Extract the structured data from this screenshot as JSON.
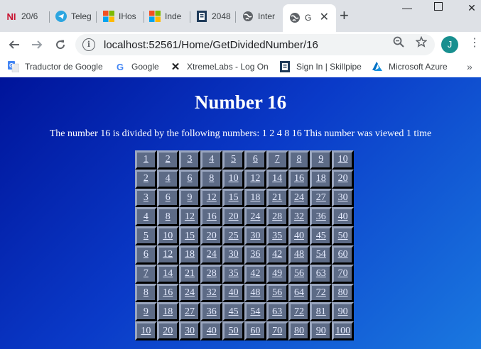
{
  "browser": {
    "tabs": [
      {
        "label": "20/6",
        "icon": "ni-icon"
      },
      {
        "label": "Teleg",
        "icon": "telegram-icon"
      },
      {
        "label": "IHos",
        "icon": "windows-icon"
      },
      {
        "label": "Inde",
        "icon": "windows-icon"
      },
      {
        "label": "2048",
        "icon": "document-icon"
      },
      {
        "label": "Inter",
        "icon": "globe-icon"
      },
      {
        "label": "G",
        "icon": "globe-icon"
      }
    ],
    "url": "localhost:52561/Home/GetDividedNumber/16",
    "avatar_letter": "J",
    "bookmarks": [
      {
        "label": "Traductor de Google",
        "icon": "google-translate-icon"
      },
      {
        "label": "Google",
        "icon": "google-icon"
      },
      {
        "label": "XtremeLabs - Log On",
        "icon": "x-icon"
      },
      {
        "label": "Sign In | Skillpipe",
        "icon": "skillpipe-icon"
      },
      {
        "label": "Microsoft Azure",
        "icon": "azure-icon"
      }
    ]
  },
  "page": {
    "title": "Number 16",
    "description": "The number 16 is divided by the following numbers: 1 2 4 8 16 This number was viewed 1 time",
    "table": [
      [
        "1",
        "2",
        "3",
        "4",
        "5",
        "6",
        "7",
        "8",
        "9",
        "10"
      ],
      [
        "2",
        "4",
        "6",
        "8",
        "10",
        "12",
        "14",
        "16",
        "18",
        "20"
      ],
      [
        "3",
        "6",
        "9",
        "12",
        "15",
        "18",
        "21",
        "24",
        "27",
        "30"
      ],
      [
        "4",
        "8",
        "12",
        "16",
        "20",
        "24",
        "28",
        "32",
        "36",
        "40"
      ],
      [
        "5",
        "10",
        "15",
        "20",
        "25",
        "30",
        "35",
        "40",
        "45",
        "50"
      ],
      [
        "6",
        "12",
        "18",
        "24",
        "30",
        "36",
        "42",
        "48",
        "54",
        "60"
      ],
      [
        "7",
        "14",
        "21",
        "28",
        "35",
        "42",
        "49",
        "56",
        "63",
        "70"
      ],
      [
        "8",
        "16",
        "24",
        "32",
        "40",
        "48",
        "56",
        "64",
        "72",
        "80"
      ],
      [
        "9",
        "18",
        "27",
        "36",
        "45",
        "54",
        "63",
        "72",
        "81",
        "90"
      ],
      [
        "10",
        "20",
        "30",
        "40",
        "50",
        "60",
        "70",
        "80",
        "90",
        "100"
      ]
    ]
  }
}
